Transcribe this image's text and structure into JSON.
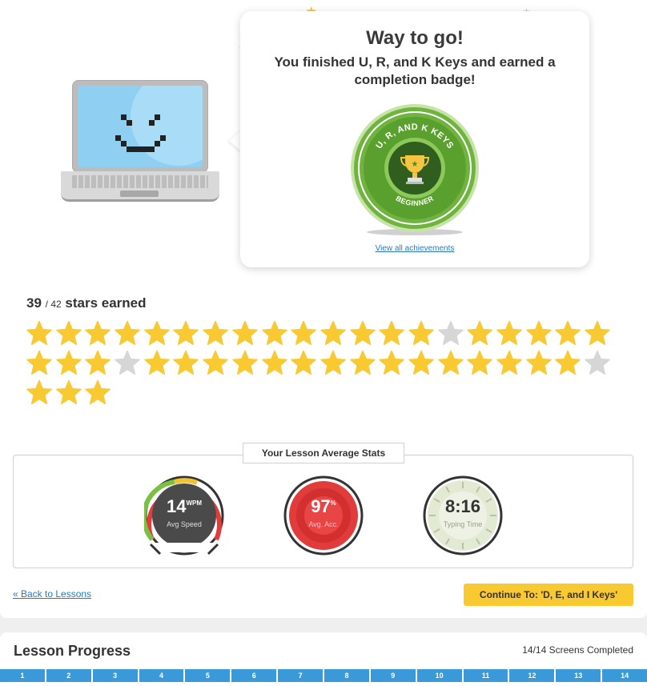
{
  "popup": {
    "title": "Way to go!",
    "message": "You finished U, R, and K Keys and earned a completion badge!",
    "view_achievements": "View all achievements"
  },
  "badge": {
    "top_text": "U, R, AND K KEYS",
    "bottom_text": "BEGINNER"
  },
  "stars": {
    "earned": "39",
    "total": "/ 42",
    "label": "stars earned",
    "states": [
      1,
      1,
      1,
      1,
      1,
      1,
      1,
      1,
      1,
      1,
      1,
      1,
      1,
      1,
      0,
      1,
      1,
      1,
      1,
      1,
      1,
      1,
      1,
      0,
      1,
      1,
      1,
      1,
      1,
      1,
      1,
      1,
      1,
      1,
      1,
      1,
      1,
      1,
      1,
      0,
      1,
      1,
      1
    ],
    "color_earned": "#f9c932",
    "color_missing": "#d6d6d6"
  },
  "stats": {
    "title": "Your Lesson Average Stats",
    "speed": {
      "value": "14",
      "unit": "WPM",
      "label": "Avg Speed"
    },
    "accuracy": {
      "value": "97",
      "unit": "%",
      "label": "Avg. Acc."
    },
    "time": {
      "value": "8:16",
      "label": "Typing Time"
    }
  },
  "nav": {
    "back": "« Back to Lessons",
    "continue": "Continue To: 'D, E, and I Keys'"
  },
  "progress": {
    "title": "Lesson Progress",
    "completed": "14/14 Screens Completed",
    "segments": [
      "1",
      "2",
      "3",
      "4",
      "5",
      "6",
      "7",
      "8",
      "9",
      "10",
      "11",
      "12",
      "13",
      "14"
    ],
    "color": "#3a9ad9"
  }
}
